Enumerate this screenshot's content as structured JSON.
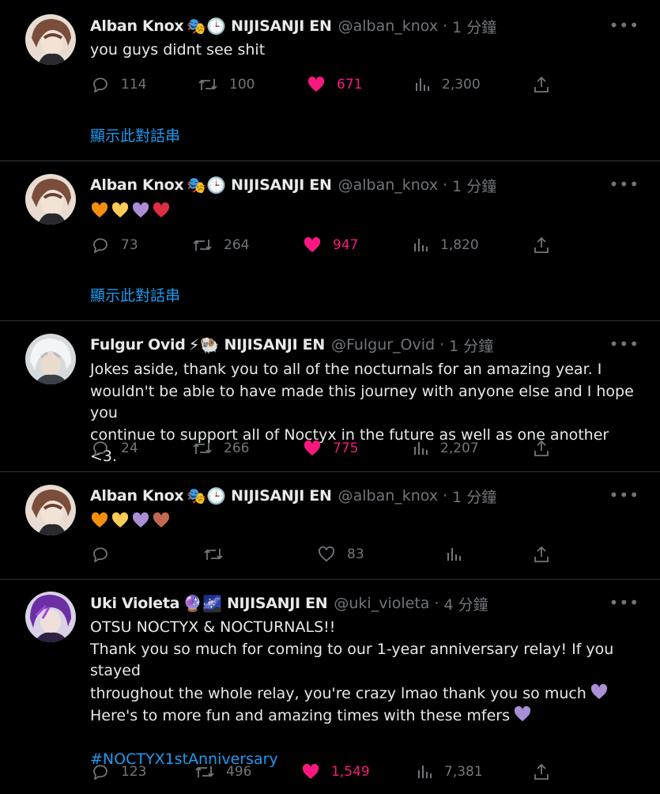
{
  "tweets": [
    {
      "name": "Alban Knox",
      "emojis": "🎭🕒",
      "org": "NIJISANJI EN",
      "handle": "@alban_knox",
      "time": "1 分鐘",
      "text": "you guys didnt see shit",
      "replies": "114",
      "retweets": "100",
      "likes": "671",
      "views": "2,300",
      "liked": true,
      "show_thread": "顯示此對話串"
    },
    {
      "name": "Alban Knox",
      "emojis": "🎭🕒",
      "org": "NIJISANJI EN",
      "handle": "@alban_knox",
      "time": "1 分鐘",
      "hearts": [
        "#f4900c",
        "#fdcb58",
        "#aa8ed6",
        "#dd2e44"
      ],
      "replies": "73",
      "retweets": "264",
      "likes": "947",
      "views": "1,820",
      "liked": true,
      "show_thread": "顯示此對話串"
    },
    {
      "name": "Fulgur Ovid",
      "emojis": "⚡🐏",
      "org": "NIJISANJI EN",
      "handle": "@Fulgur_Ovid",
      "time": "1 分鐘",
      "lines": [
        "Jokes aside, thank you to all of the nocturnals for an amazing year. I",
        "wouldn't be able to have made this journey with anyone else and I hope you",
        "continue to support all of Noctyx in the future as well as one another <3."
      ],
      "replies": "24",
      "retweets": "266",
      "likes": "775",
      "views": "2,207",
      "liked": true
    },
    {
      "name": "Alban Knox",
      "emojis": "🎭🕒",
      "org": "NIJISANJI EN",
      "handle": "@alban_knox",
      "time": "1 分鐘",
      "hearts": [
        "#f4900c",
        "#fdcb58",
        "#aa8ed6",
        "#c1694f"
      ],
      "replies": "",
      "retweets": "",
      "likes": "83",
      "views": "",
      "liked": false
    },
    {
      "name": "Uki Violeta",
      "emojis": "🔮🌌",
      "org": "NIJISANJI EN",
      "handle": "@uki_violeta",
      "time": "4 分鐘",
      "lines": [
        "OTSU NOCTYX & NOCTURNALS!!",
        "Thank you so much for coming to our 1-year anniversary relay! If you stayed",
        "throughout the whole relay, you're crazy lmao thank you so much",
        "Here's to more fun and amazing times with these mfers"
      ],
      "hashtag": "#NOCTYX1stAnniversary",
      "replies": "123",
      "retweets": "496",
      "likes": "1,549",
      "views": "7,381",
      "liked": true
    }
  ],
  "more_icon": "more-dots-icon",
  "colors": {
    "like": "#f91880",
    "link": "#1d9bf0",
    "muted": "#71767b",
    "purple_heart": "#aa8ed6"
  }
}
